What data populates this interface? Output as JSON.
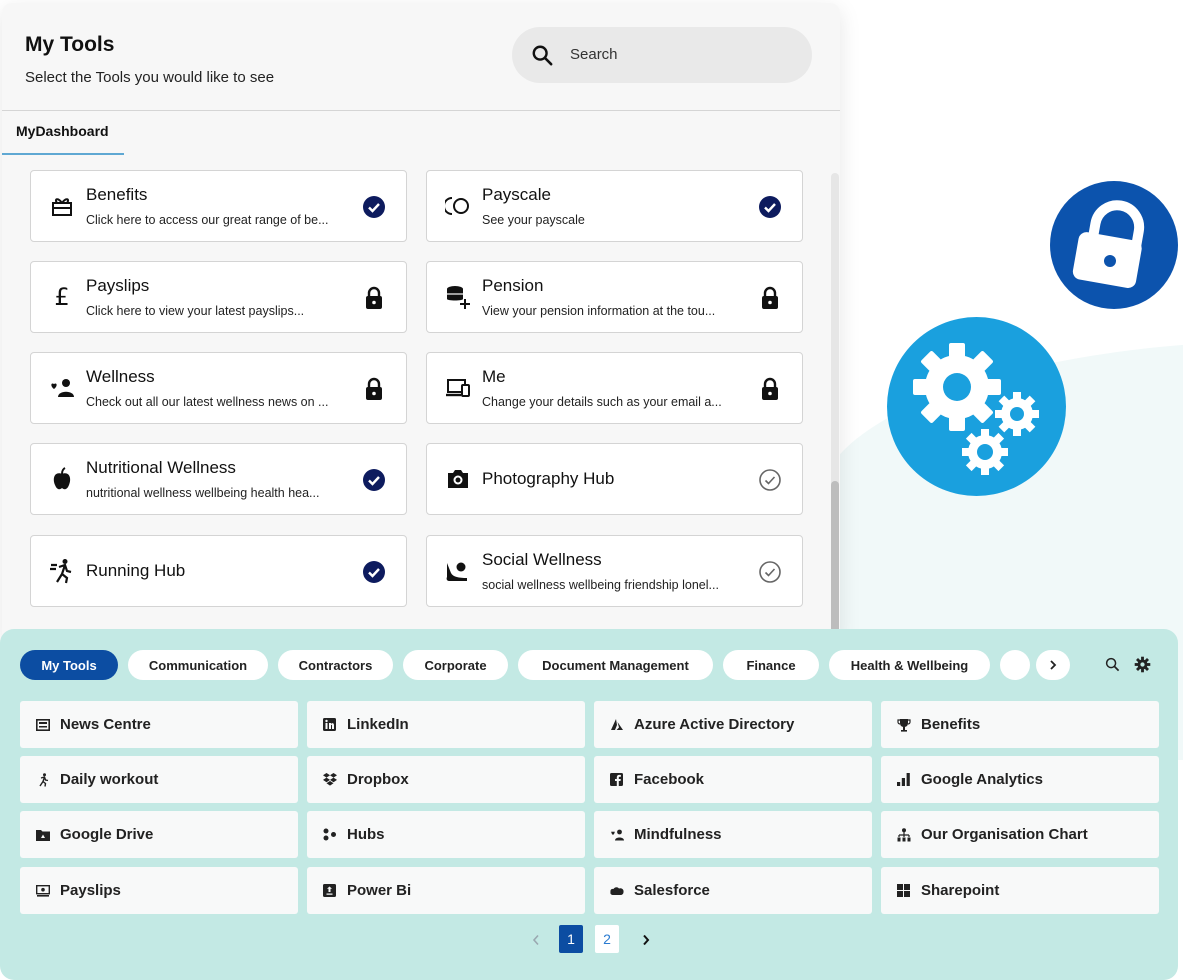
{
  "panel": {
    "title": "My Tools",
    "subtitle": "Select the Tools you would like to see",
    "search_placeholder": "Search",
    "tab": "MyDashboard",
    "cards": [
      {
        "title": "Benefits",
        "desc": "Click here to access our great range of be...",
        "icon": "gift-icon",
        "status": "selected"
      },
      {
        "title": "Payscale",
        "desc": "See your payscale",
        "icon": "payscale-icon",
        "status": "selected"
      },
      {
        "title": "Payslips",
        "desc": "Click here to view your latest payslips...",
        "icon": "pound-icon",
        "status": "locked"
      },
      {
        "title": "Pension",
        "desc": "View your pension information at the tou...",
        "icon": "coins-icon",
        "status": "locked"
      },
      {
        "title": "Wellness",
        "desc": "Check out all our latest wellness news on ...",
        "icon": "wellness-icon",
        "status": "locked"
      },
      {
        "title": "Me",
        "desc": "Change your details such as your email a...",
        "icon": "devices-icon",
        "status": "locked"
      },
      {
        "title": "Nutritional Wellness",
        "desc": "nutritional wellness wellbeing health hea...",
        "icon": "apple-icon",
        "status": "selected"
      },
      {
        "title": "Photography Hub",
        "desc": "",
        "icon": "camera-icon",
        "status": "unselected"
      },
      {
        "title": "Running Hub",
        "desc": "",
        "icon": "running-icon",
        "status": "selected"
      },
      {
        "title": "Social Wellness",
        "desc": "social wellness wellbeing friendship lonel...",
        "icon": "social-icon",
        "status": "unselected"
      }
    ]
  },
  "tools": {
    "categories": [
      {
        "label": "My Tools",
        "active": true
      },
      {
        "label": "Communication",
        "active": false
      },
      {
        "label": "Contractors",
        "active": false
      },
      {
        "label": "Corporate",
        "active": false
      },
      {
        "label": "Document Management",
        "active": false
      },
      {
        "label": "Finance",
        "active": false
      },
      {
        "label": "Health & Wellbeing",
        "active": false
      }
    ],
    "tiles": [
      {
        "label": "News Centre",
        "icon": "newspaper-icon"
      },
      {
        "label": "LinkedIn",
        "icon": "linkedin-icon"
      },
      {
        "label": "Azure Active Directory",
        "icon": "azure-icon"
      },
      {
        "label": "Benefits",
        "icon": "trophy-icon"
      },
      {
        "label": "Daily workout",
        "icon": "running-icon"
      },
      {
        "label": "Dropbox",
        "icon": "dropbox-icon"
      },
      {
        "label": "Facebook",
        "icon": "facebook-icon"
      },
      {
        "label": "Google Analytics",
        "icon": "analytics-icon"
      },
      {
        "label": "Google Drive",
        "icon": "folder-icon"
      },
      {
        "label": "Hubs",
        "icon": "hubs-icon"
      },
      {
        "label": "Mindfulness",
        "icon": "mindfulness-icon"
      },
      {
        "label": "Our Organisation Chart",
        "icon": "org-chart-icon"
      },
      {
        "label": "Payslips",
        "icon": "payslip-icon"
      },
      {
        "label": "Power Bi",
        "icon": "powerbi-icon"
      },
      {
        "label": "Salesforce",
        "icon": "salesforce-icon"
      },
      {
        "label": "Sharepoint",
        "icon": "sharepoint-icon"
      }
    ],
    "pages": [
      "1",
      "2"
    ],
    "current_page": 1
  },
  "colors": {
    "primary": "#0c4da2",
    "selected_check": "#0d1b5e",
    "tools_bg": "#c3e9e4",
    "lock_bg": "#0c53ad",
    "gear_bg": "#1aa0de"
  }
}
